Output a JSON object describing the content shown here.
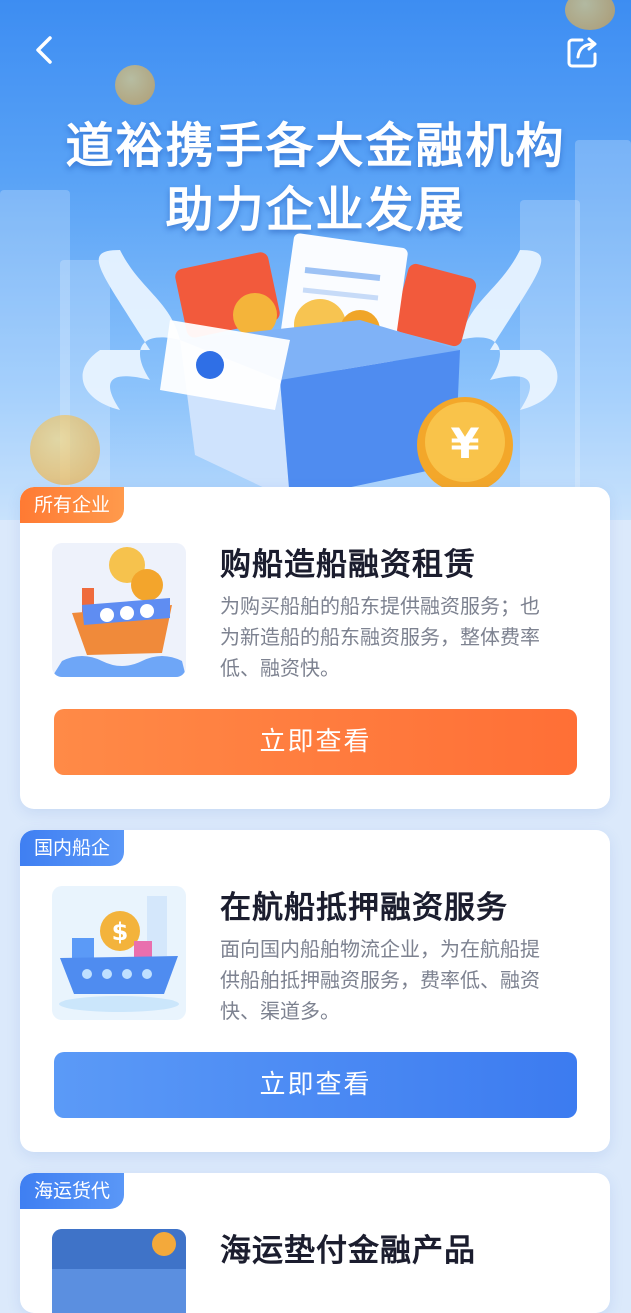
{
  "header": {
    "title_line1": "道裕携手各大金融机构",
    "title_line2": "助力企业发展",
    "back_icon": "chevron-left-icon",
    "share_icon": "share-icon"
  },
  "colors": {
    "orange_accent": "#FF7A3A",
    "blue_accent": "#3F7FF2",
    "title_text": "#1B1D2E",
    "desc_text": "#7D8290"
  },
  "products": [
    {
      "tag": "所有企业",
      "title": "购船造船融资租赁",
      "description": "为购买船舶的船东提供融资服务；也为新造船的船东融资服务，整体费率低、融资快。",
      "button": "立即查看",
      "theme": "orange"
    },
    {
      "tag": "国内船企",
      "title": "在航船抵押融资服务",
      "description": "面向国内船舶物流企业，为在航船提供船舶抵押融资服务，费率低、融资快、渠道多。",
      "button": "立即查看",
      "theme": "blue"
    },
    {
      "tag": "海运货代",
      "title": "海运垫付金融产品",
      "description": "",
      "button": "",
      "theme": "blue"
    }
  ]
}
